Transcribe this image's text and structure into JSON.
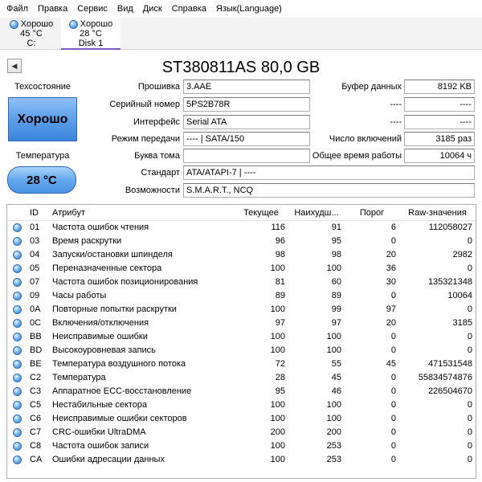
{
  "menu": [
    "Файл",
    "Правка",
    "Сервис",
    "Вид",
    "Диск",
    "Справка",
    "Язык(Language)"
  ],
  "disks": [
    {
      "status": "Хорошо",
      "temp": "45 °C",
      "name": "C:",
      "active": false
    },
    {
      "status": "Хорошо",
      "temp": "28 °C",
      "name": "Disk 1",
      "active": true
    }
  ],
  "title": "ST380811AS 80,0 GB",
  "left_panel": {
    "health_label": "Техсостояние",
    "health_value": "Хорошо",
    "temp_label": "Температура",
    "temp_value": "28 °C"
  },
  "info": {
    "firmware_label": "Прошивка",
    "firmware": "3.AAE",
    "serial_label": "Серийный номер",
    "serial": "5PS2B78R",
    "interface_label": "Интерфейс",
    "interface": "Serial ATA",
    "transfer_label": "Режим передачи",
    "transfer": "---- | SATA/150",
    "drive_letter_label": "Буква тома",
    "drive_letter": "",
    "standard_label": "Стандарт",
    "standard": "ATA/ATAPI-7 | ----",
    "features_label": "Возможности",
    "features": "S.M.A.R.T., NCQ",
    "buffer_label": "Буфер данных",
    "buffer": "8192 KB",
    "r2_label": "----",
    "r2": "----",
    "r3_label": "----",
    "r3": "----",
    "power_on_count_label": "Число включений",
    "power_on_count": "3185 раз",
    "power_on_hours_label": "Общее время работы",
    "power_on_hours": "10064 ч"
  },
  "table": {
    "headers": {
      "id": "ID",
      "attr": "Атрибут",
      "cur": "Текущее",
      "worst": "Наихудш...",
      "thr": "Порог",
      "raw": "Raw-значения"
    },
    "rows": [
      {
        "id": "01",
        "attr": "Частота ошибок чтения",
        "cur": "116",
        "worst": "91",
        "thr": "6",
        "raw": "112058027"
      },
      {
        "id": "03",
        "attr": "Время раскрутки",
        "cur": "96",
        "worst": "95",
        "thr": "0",
        "raw": "0"
      },
      {
        "id": "04",
        "attr": "Запуски/остановки шпинделя",
        "cur": "98",
        "worst": "98",
        "thr": "20",
        "raw": "2982"
      },
      {
        "id": "05",
        "attr": "Переназначенные сектора",
        "cur": "100",
        "worst": "100",
        "thr": "36",
        "raw": "0"
      },
      {
        "id": "07",
        "attr": "Частота ошибок позиционирования",
        "cur": "81",
        "worst": "60",
        "thr": "30",
        "raw": "135321348"
      },
      {
        "id": "09",
        "attr": "Часы работы",
        "cur": "89",
        "worst": "89",
        "thr": "0",
        "raw": "10064"
      },
      {
        "id": "0A",
        "attr": "Повторные попытки раскрутки",
        "cur": "100",
        "worst": "99",
        "thr": "97",
        "raw": "0"
      },
      {
        "id": "0C",
        "attr": "Включения/отключения",
        "cur": "97",
        "worst": "97",
        "thr": "20",
        "raw": "3185"
      },
      {
        "id": "BB",
        "attr": "Неисправимые ошибки",
        "cur": "100",
        "worst": "100",
        "thr": "0",
        "raw": "0"
      },
      {
        "id": "BD",
        "attr": "Высокоуровневая запись",
        "cur": "100",
        "worst": "100",
        "thr": "0",
        "raw": "0"
      },
      {
        "id": "BE",
        "attr": "Температура воздушного потока",
        "cur": "72",
        "worst": "55",
        "thr": "45",
        "raw": "471531548"
      },
      {
        "id": "C2",
        "attr": "Температура",
        "cur": "28",
        "worst": "45",
        "thr": "0",
        "raw": "55834574876"
      },
      {
        "id": "C3",
        "attr": "Аппаратное ECC-восстановление",
        "cur": "95",
        "worst": "46",
        "thr": "0",
        "raw": "226504670"
      },
      {
        "id": "C5",
        "attr": "Нестабильные сектора",
        "cur": "100",
        "worst": "100",
        "thr": "0",
        "raw": "0"
      },
      {
        "id": "C6",
        "attr": "Неисправимые ошибки секторов",
        "cur": "100",
        "worst": "100",
        "thr": "0",
        "raw": "0"
      },
      {
        "id": "C7",
        "attr": "CRC-ошибки UltraDMA",
        "cur": "200",
        "worst": "200",
        "thr": "0",
        "raw": "0"
      },
      {
        "id": "C8",
        "attr": "Частота ошибок записи",
        "cur": "100",
        "worst": "253",
        "thr": "0",
        "raw": "0"
      },
      {
        "id": "CA",
        "attr": "Ошибки адресации данных",
        "cur": "100",
        "worst": "253",
        "thr": "0",
        "raw": "0"
      }
    ]
  }
}
